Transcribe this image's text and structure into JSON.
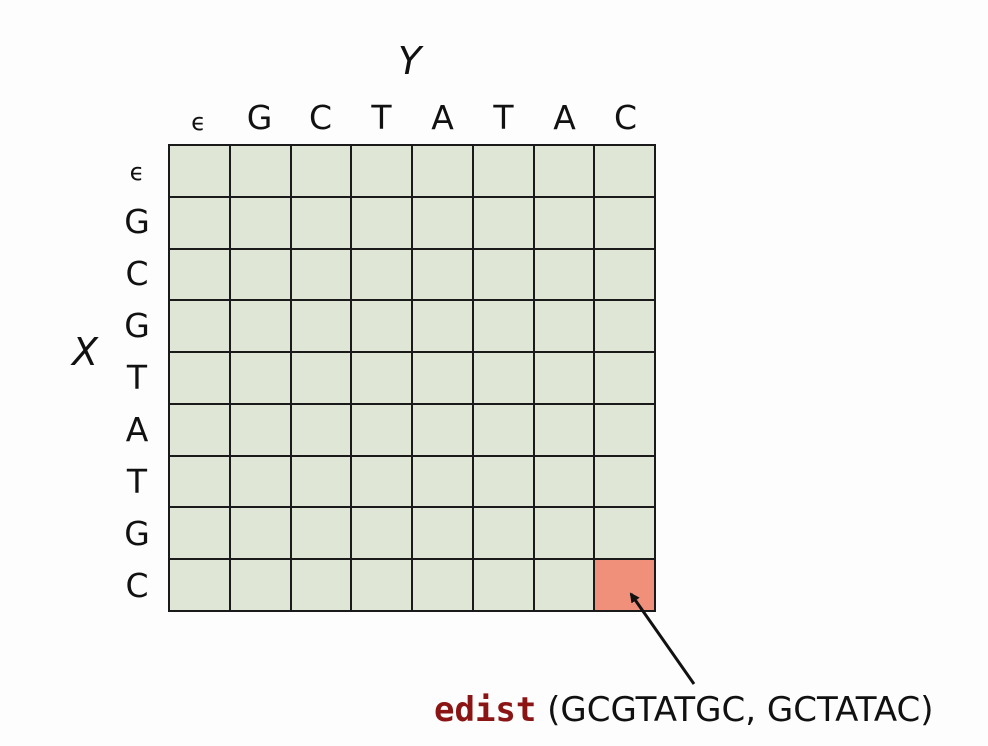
{
  "y_label": "Y",
  "x_label": "X",
  "columns": [
    "ϵ",
    "G",
    "C",
    "T",
    "A",
    "T",
    "A",
    "C"
  ],
  "rows": [
    "ϵ",
    "G",
    "C",
    "G",
    "T",
    "A",
    "T",
    "G",
    "C"
  ],
  "highlight": {
    "row": 8,
    "col": 7,
    "color": "#f0907b"
  },
  "cell_color": "#dfe6d6",
  "caption": {
    "function": "edist",
    "args": "(GCGTATGC, GCTATAC)"
  }
}
